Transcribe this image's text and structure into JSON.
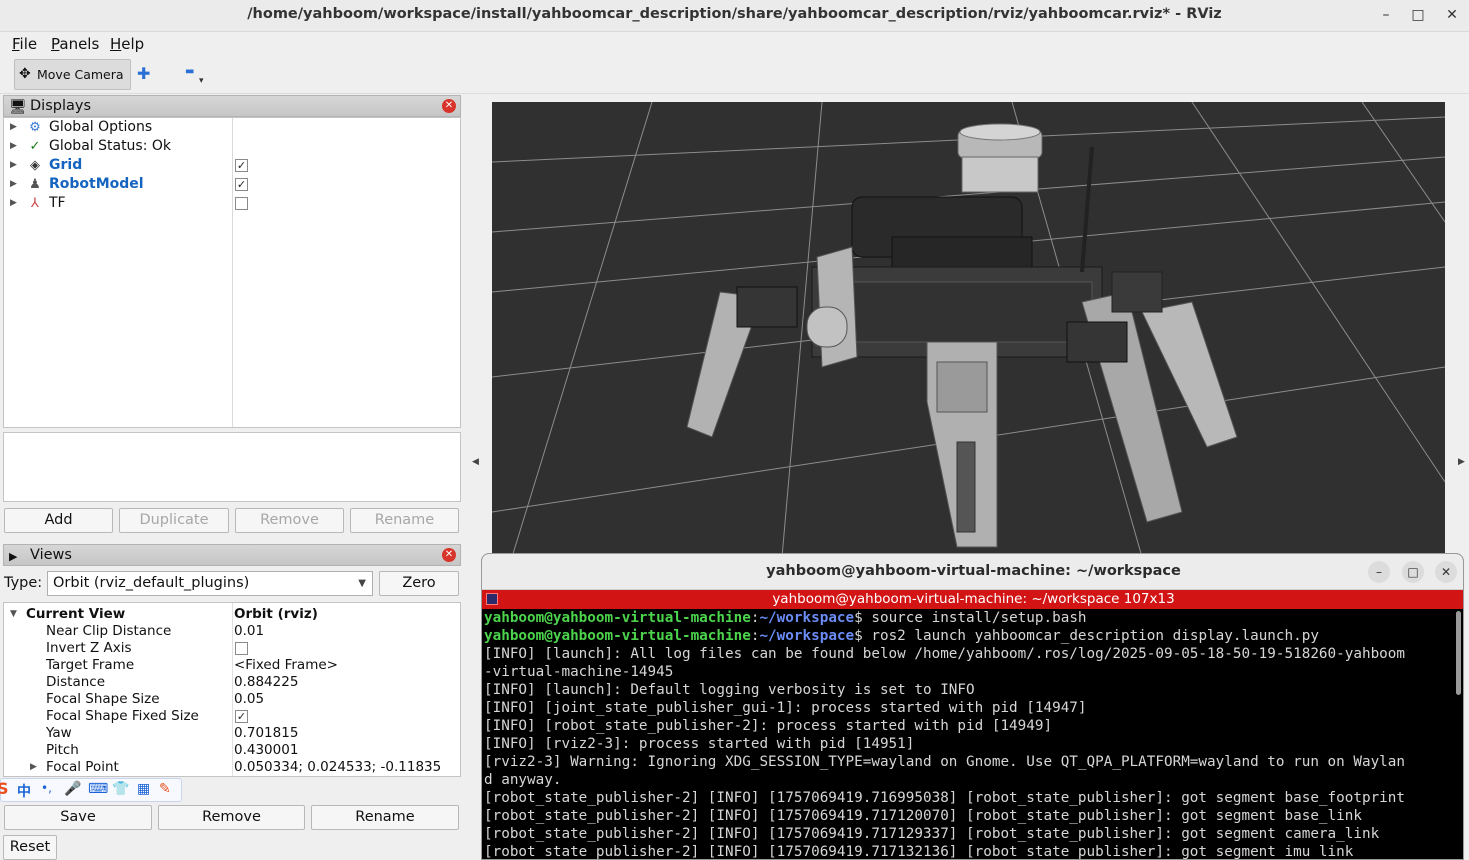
{
  "window": {
    "title": "/home/yahboom/workspace/install/yahboomcar_description/share/yahboomcar_description/rviz/yahboomcar.rviz* - RViz",
    "minimize": "–",
    "maximize": "□",
    "close": "✕"
  },
  "menu": {
    "file_u": "F",
    "file_rest": "ile",
    "panels_u": "P",
    "panels_rest": "anels",
    "help_u": "H",
    "help_rest": "elp"
  },
  "toolbar": {
    "move_camera": "Move Camera",
    "plus": "✚",
    "minus": "▬",
    "minus_caret": "▾"
  },
  "displays": {
    "title": "Displays",
    "close": "✕",
    "items": [
      {
        "label": "Global Options",
        "icon": "⚙",
        "checkbox": null
      },
      {
        "label": "Global Status: Ok",
        "icon": "✓",
        "checkbox": null
      },
      {
        "label": "Grid",
        "icon": "◈",
        "checkbox": "✓"
      },
      {
        "label": "RobotModel",
        "icon": "♟",
        "checkbox": "✓"
      },
      {
        "label": "TF",
        "icon": "⅄",
        "checkbox": ""
      }
    ],
    "buttons": {
      "add": "Add",
      "duplicate": "Duplicate",
      "remove": "Remove",
      "rename": "Rename"
    }
  },
  "views": {
    "title": "Views",
    "close": "✕",
    "type_label": "Type:",
    "type_value": "Orbit (rviz_default_plugins)",
    "zero": "Zero",
    "current_view": {
      "name": "Current View",
      "value": "Orbit (rviz)"
    },
    "properties": [
      {
        "name": "Near Clip Distance",
        "value": "0.01"
      },
      {
        "name": "Invert Z Axis",
        "value": ""
      },
      {
        "name": "Target Frame",
        "value": "<Fixed Frame>"
      },
      {
        "name": "Distance",
        "value": "0.884225"
      },
      {
        "name": "Focal Shape Size",
        "value": "0.05"
      },
      {
        "name": "Focal Shape Fixed Size",
        "value": "✓"
      },
      {
        "name": "Yaw",
        "value": "0.701815"
      },
      {
        "name": "Pitch",
        "value": "0.430001"
      },
      {
        "name": "Focal Point",
        "value": "0.050334; 0.024533; -0.11835"
      }
    ],
    "buttons": {
      "save": "Save",
      "remove": "Remove",
      "rename": "Rename",
      "reset": "Reset"
    }
  },
  "ime": {
    "chinese": "中",
    "punct": "•,",
    "mic": "🎤",
    "keyboard": "⌨",
    "skin": "👕",
    "apps": "▦"
  },
  "terminal": {
    "title": "yahboom@yahboom-virtual-machine: ~/workspace",
    "tab_title": "yahboom@yahboom-virtual-machine: ~/workspace 107x13",
    "prompt_user": "yahboom@yahboom-virtual-machine",
    "prompt_sep": ":",
    "prompt_path": "~/workspace",
    "cmd1": "$ source install/setup.bash",
    "cmd2": "$ ros2 launch yahboomcar_description display.launch.py",
    "log": [
      "[INFO] [launch]: All log files can be found below /home/yahboom/.ros/log/2025-09-05-18-50-19-518260-yahboom",
      "-virtual-machine-14945",
      "[INFO] [launch]: Default logging verbosity is set to INFO",
      "[INFO] [joint_state_publisher_gui-1]: process started with pid [14947]",
      "[INFO] [robot_state_publisher-2]: process started with pid [14949]",
      "[INFO] [rviz2-3]: process started with pid [14951]",
      "[rviz2-3] Warning: Ignoring XDG_SESSION_TYPE=wayland on Gnome. Use QT_QPA_PLATFORM=wayland to run on Waylan",
      "d anyway.",
      "[robot_state_publisher-2] [INFO] [1757069419.716995038] [robot_state_publisher]: got segment base_footprint",
      "[robot_state_publisher-2] [INFO] [1757069419.717120070] [robot_state_publisher]: got segment base_link",
      "[robot_state_publisher-2] [INFO] [1757069419.717129337] [robot_state_publisher]: got segment camera_link",
      "[robot_state_publisher-2] [INFO] [1757069419.717132136] [robot_state_publisher]: got segment imu_link"
    ]
  }
}
